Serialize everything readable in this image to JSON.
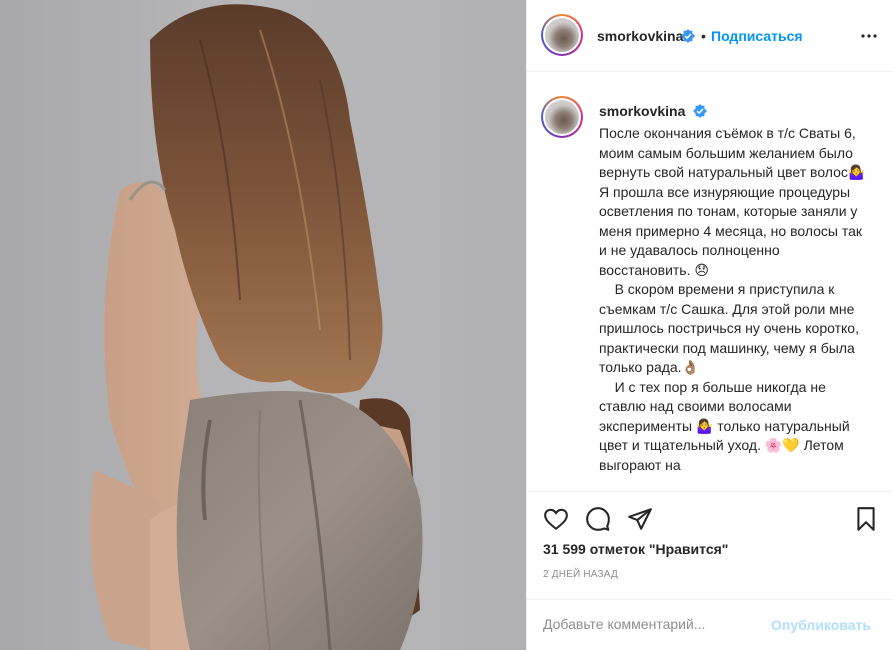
{
  "post": {
    "photo_alt": "smorkovkina"
  },
  "header": {
    "username": "smorkovkina",
    "separator": "•",
    "follow_label": "Подписаться"
  },
  "caption": {
    "username": "smorkovkina",
    "text": "После окончания съёмок в т/с Сваты 6, моим самым большим желанием было вернуть свой натуральный цвет волос🤷‍♀️ Я прошла все изнуряющие процедуры осветления по тонам, которые заняли у меня примерно 4 месяца, но волосы так и не удавалось полноценно восстановить. 😞\n    В скором времени я приступила к съемкам т/с Сашка. Для этой роли мне пришлось постричься ну очень коротко, практически под машинку, чему я была только рада.👌🏽\n    И с тех пор я больше никогда не ставлю над своими волосами эксперименты 🤷‍♀️ только натуральный цвет и тщательный уход. 🌸💛 Летом выгорают на"
  },
  "actions": {
    "likes_text": "31 599 отметок \"Нравится\"",
    "timestamp": "2 ДНЕЙ НАЗАД"
  },
  "comment": {
    "placeholder": "Добавьте комментарий...",
    "publish_label": "Опубликовать"
  },
  "colors": {
    "accent": "#0095f6",
    "publish_disabled": "#b2dffc",
    "verified": "#3897f0",
    "muted": "#8e8e8e"
  },
  "icons": {
    "like": "heart-icon",
    "comment": "comment-icon",
    "share": "paper-plane-icon",
    "save": "bookmark-icon",
    "verified": "verified-badge-icon",
    "more": "more-options-icon"
  }
}
